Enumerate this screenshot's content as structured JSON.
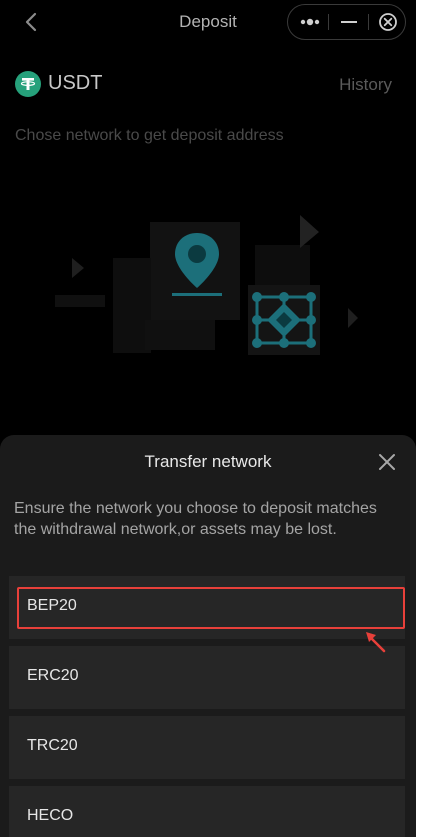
{
  "header": {
    "title": "Deposit",
    "icons": [
      "back-chevron-icon",
      "more-dots-icon",
      "minimize-icon",
      "close-circle-icon"
    ]
  },
  "coin": {
    "name": "USDT",
    "icon": "tether-icon",
    "icon_color": "#26a17b",
    "history_label": "History"
  },
  "hint": "Chose network to get deposit address",
  "illustration_colors": {
    "teal": "#1c6f7a",
    "block": "#1e1e1e"
  },
  "sheet": {
    "title": "Transfer network",
    "note": "Ensure the network you choose to deposit matches the withdrawal network,or assets may be lost.",
    "networks": [
      {
        "label": "BEP20"
      },
      {
        "label": "ERC20"
      },
      {
        "label": "TRC20"
      },
      {
        "label": "HECO"
      }
    ]
  },
  "annotation": {
    "highlight_color": "#e8403a",
    "highlighted_item": "BEP20"
  }
}
